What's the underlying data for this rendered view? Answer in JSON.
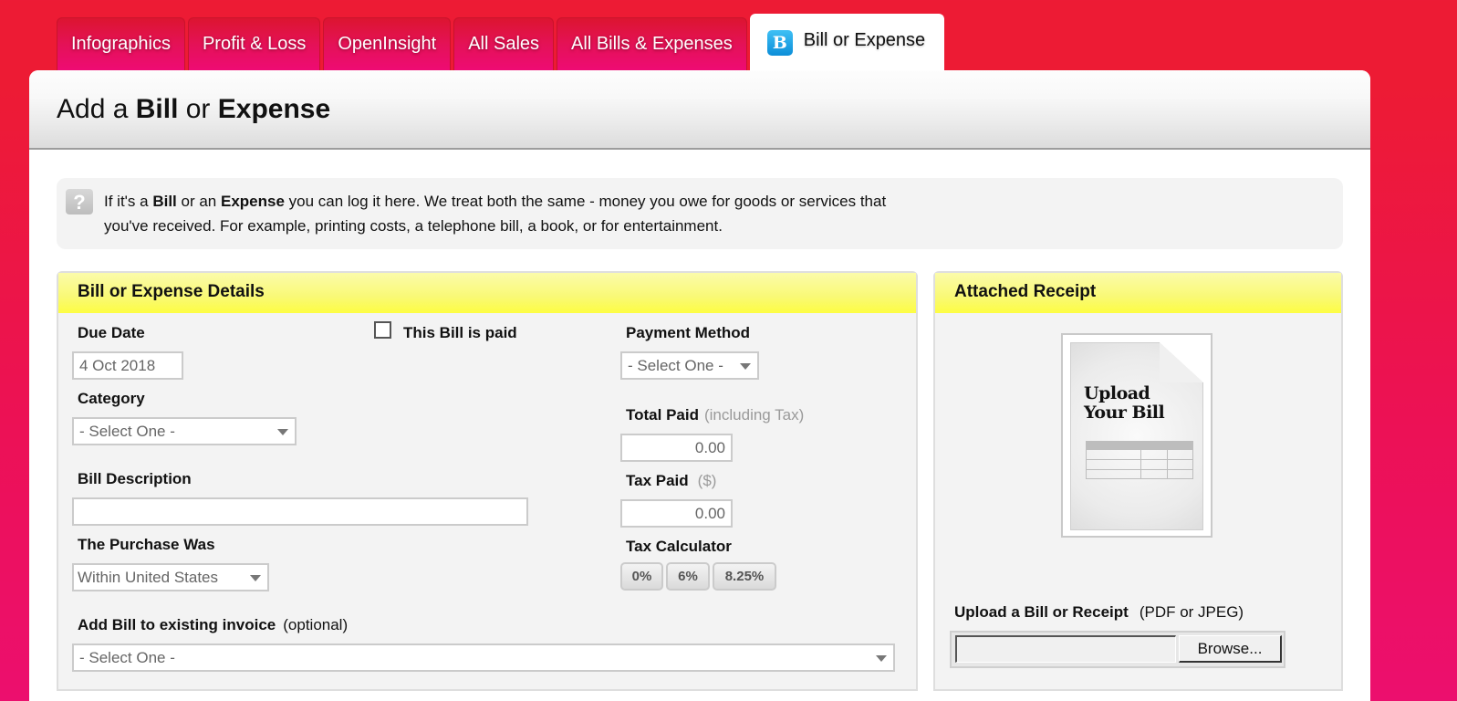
{
  "tabs": [
    {
      "label": "Infographics",
      "active": false
    },
    {
      "label": "Profit & Loss",
      "active": false
    },
    {
      "label": "OpenInsight",
      "active": false
    },
    {
      "label": "All Sales",
      "active": false
    },
    {
      "label": "All Bills & Expenses",
      "active": false
    },
    {
      "label": "Bill or Expense",
      "active": true,
      "icon": "B-app-logo-icon",
      "icon_letter": "B"
    }
  ],
  "header": {
    "title_parts": [
      "Add a ",
      "Bill",
      " or ",
      "Expense"
    ]
  },
  "info": {
    "icon": "question-mark-icon",
    "icon_glyph": "?",
    "line1_parts": [
      "If it's a ",
      "Bill",
      " or an ",
      "Expense",
      " you can log it here. We treat both the same - money you owe for goods or services that"
    ],
    "line2": "you've received. For example, printing costs, a telephone bill, a book, or for entertainment."
  },
  "details": {
    "title": "Bill or Expense Details",
    "due_date": {
      "label": "Due Date",
      "value": "4 Oct 2018"
    },
    "paid_checkbox": {
      "label": "This Bill is paid",
      "checked": false
    },
    "payment_method": {
      "label": "Payment Method",
      "value": "- Select One -"
    },
    "category": {
      "label": "Category",
      "value": "- Select One -"
    },
    "total_paid": {
      "label": "Total Paid",
      "hint": "(including Tax)",
      "value": "0.00"
    },
    "bill_description": {
      "label": "Bill Description",
      "value": ""
    },
    "tax_paid": {
      "label": "Tax Paid",
      "hint": "($)",
      "value": "0.00"
    },
    "purchase_was": {
      "label": "The Purchase Was",
      "value": "Within United States"
    },
    "tax_calculator": {
      "label": "Tax Calculator",
      "buttons": [
        "0%",
        "6%",
        "8.25%"
      ]
    },
    "existing_invoice": {
      "label": "Add Bill to existing invoice",
      "hint": "(optional)",
      "value": "- Select One -"
    }
  },
  "receipt": {
    "title": "Attached Receipt",
    "placeholder_image": {
      "line1": "Upload",
      "line2": "Your Bill"
    },
    "upload_label": "Upload a Bill or Receipt",
    "upload_hint": "(PDF or JPEG)",
    "file_value": "",
    "browse_label": "Browse..."
  },
  "colors": {
    "background_top": "#ed1b34",
    "background_bottom": "#ec0f6e",
    "panel_header_yellow": "#fdfd42",
    "logo_blue": "#0c8ed8"
  }
}
